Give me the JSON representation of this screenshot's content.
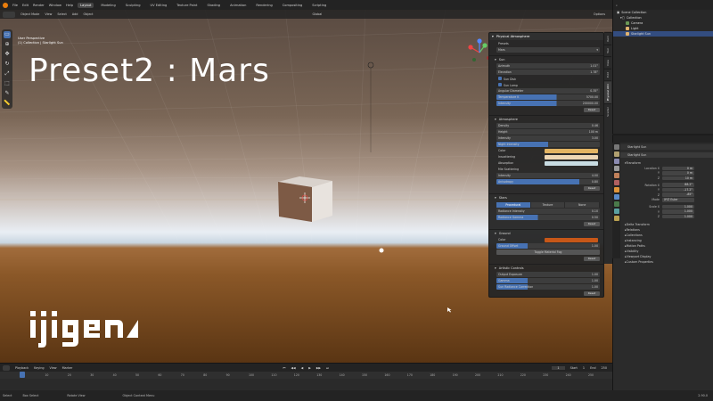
{
  "menu": {
    "items": [
      "File",
      "Edit",
      "Render",
      "Window",
      "Help"
    ],
    "workspaces": [
      "Layout",
      "Modeling",
      "Sculpting",
      "UV Editing",
      "Texture Paint",
      "Shading",
      "Animation",
      "Rendering",
      "Compositing",
      "Scripting"
    ],
    "active_workspace": "Layout",
    "scene": "Scene",
    "view_layer": "View Layer"
  },
  "viewport": {
    "mode": "Object Mode",
    "menu": [
      "View",
      "Select",
      "Add",
      "Object"
    ],
    "orientation": "Global",
    "options": "Options",
    "perspective": "User Perspective",
    "collection_info": "(1) Collection | Starlight Sun",
    "overlay_title": "Preset2 : Mars"
  },
  "atmosphere_panel": {
    "title": "Physical Atmosphere",
    "presets_label": "Presets",
    "preset_value": "Mars",
    "sun": {
      "header": "Sun",
      "azimuth": {
        "label": "Azimuth",
        "value": "1.01°"
      },
      "elevation": {
        "label": "Elevation",
        "value": "1.78°"
      },
      "sun_disk": "Sun Disk",
      "sun_lamp": "Sun Lamp",
      "angular_diameter": {
        "label": "Angular Diameter",
        "value": "0.35°"
      },
      "temperature": {
        "label": "Temperature K",
        "value": "5700.00"
      },
      "intensity": {
        "label": "Intensity",
        "value": "200000.00"
      }
    },
    "atmosphere": {
      "header": "Atmosphere",
      "density": {
        "label": "Density",
        "value": "0.46"
      },
      "height": {
        "label": "Height",
        "value": "100 m"
      },
      "intensity": {
        "label": "Intensity",
        "value": "3.00"
      },
      "night_intensity": {
        "label": "Night Intensity",
        "value": ""
      },
      "color_label": "Color",
      "inscattering_label": "Inscattering",
      "absorption_label": "Absorption",
      "mie_label": "Mie Scattering",
      "mie_intensity": {
        "label": "Intensity",
        "value": "4.00"
      },
      "anisotropy": {
        "label": "Anisotropy",
        "value": "0.80"
      },
      "colors": {
        "color": "#e3b463",
        "inscattering": "#eed7b5",
        "absorption": "#c8dce2"
      }
    },
    "stars": {
      "header": "Stars",
      "tabs": [
        "Procedural",
        "Texture",
        "None"
      ],
      "active_tab": "Procedural",
      "radiance_intensity": {
        "label": "Radiance Intensity",
        "value": "0.10"
      },
      "radiance_gamma": {
        "label": "Radiance Gamma",
        "value": "0.50"
      }
    },
    "ground": {
      "header": "Ground",
      "color_label": "Color",
      "color": "#c75718",
      "offset": {
        "label": "Ground Offset",
        "value": "1.00"
      },
      "toggle_fog": "Toggle Material Fog"
    },
    "artistic": {
      "header": "Artistic Controls",
      "exposure": {
        "label": "Output Exposure",
        "value": "1.00"
      },
      "gamma": {
        "label": "Gamma",
        "value": "1.00"
      },
      "sun_radiance_gamma": {
        "label": "Sun Radiance Correction",
        "value": "1.00"
      }
    },
    "reset": "Reset"
  },
  "sidebar_tabs": [
    "Item",
    "Tool",
    "View",
    "Edit",
    "Physical Atm",
    "Scatter"
  ],
  "outliner": {
    "root": "Scene Collection",
    "items": [
      {
        "name": "Collection",
        "icon": "collection-icon",
        "color": "#d8d8d8"
      },
      {
        "name": "Camera",
        "icon": "camera-icon",
        "color": "#6a9955"
      },
      {
        "name": "Light",
        "icon": "light-icon",
        "color": "#e0b36f"
      },
      {
        "name": "Starlight Sun",
        "icon": "sun-icon",
        "color": "#e0b36f"
      }
    ]
  },
  "properties": {
    "object_name": "Starlight Sun",
    "data_name": "Starlight Sun",
    "section": "Transform",
    "location": {
      "label": "Location X",
      "x": "0 m",
      "y": "0 m",
      "z": "10 m"
    },
    "rotation": {
      "label": "Rotation X",
      "x": "88.2°",
      "y": "-17.2°",
      "z": "-85°"
    },
    "mode": {
      "label": "Mode",
      "value": "XYZ Euler"
    },
    "scale": {
      "label": "Scale X",
      "x": "1.000",
      "y": "1.000",
      "z": "1.000"
    },
    "collapsed": [
      "Delta Transform",
      "Relations",
      "Collections",
      "Instancing",
      "Motion Paths",
      "Visibility",
      "Viewport Display",
      "Custom Properties"
    ]
  },
  "timeline": {
    "menu": [
      "Playback",
      "Keying",
      "View",
      "Marker"
    ],
    "current_frame": "1",
    "start_label": "Start",
    "start": "1",
    "end_label": "End",
    "end": "250",
    "ticks": [
      "0",
      "10",
      "20",
      "30",
      "40",
      "50",
      "60",
      "70",
      "80",
      "90",
      "100",
      "110",
      "120",
      "130",
      "140",
      "150",
      "160",
      "170",
      "180",
      "190",
      "200",
      "210",
      "220",
      "230",
      "240",
      "250"
    ]
  },
  "statusbar": {
    "select": "Select",
    "box_select": "Box Select",
    "rotate_view": "Rotate View",
    "context_menu": "Object Context Menu",
    "version": "2.90.0"
  },
  "colors": {
    "accent": "#4772b3",
    "brand": "#e87d0d"
  }
}
